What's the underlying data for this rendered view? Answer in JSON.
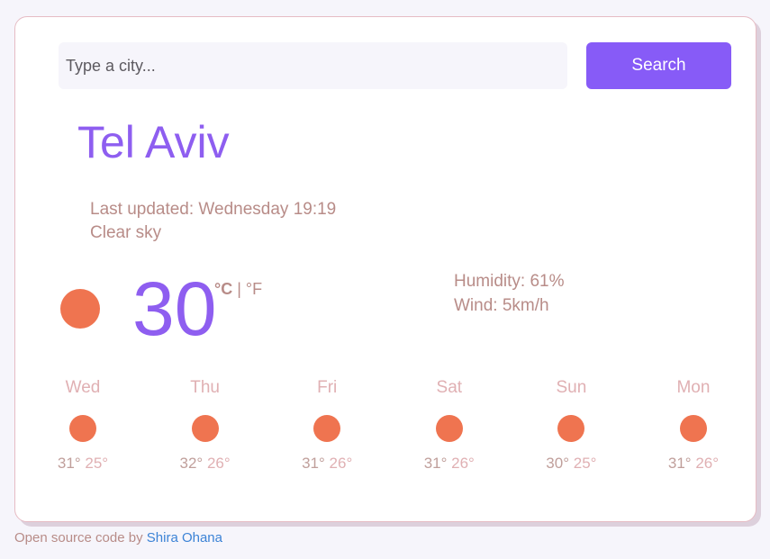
{
  "search": {
    "placeholder": "Type a city...",
    "value": "",
    "button_label": "Search"
  },
  "weather": {
    "city": "Tel Aviv",
    "last_updated": "Last updated: Wednesday 19:19",
    "description": "Clear sky",
    "temperature": "30",
    "unit_celsius": "°C",
    "unit_separator": "|",
    "unit_fahrenheit": "°F",
    "humidity": "Humidity: 61%",
    "wind": "Wind: 5km/h",
    "icon": "sun-icon"
  },
  "forecast": [
    {
      "day": "Wed",
      "max": "31°",
      "min": "25°",
      "icon": "sun-icon"
    },
    {
      "day": "Thu",
      "max": "32°",
      "min": "26°",
      "icon": "sun-icon"
    },
    {
      "day": "Fri",
      "max": "31°",
      "min": "26°",
      "icon": "sun-icon"
    },
    {
      "day": "Sat",
      "max": "31°",
      "min": "26°",
      "icon": "sun-icon"
    },
    {
      "day": "Sun",
      "max": "30°",
      "min": "25°",
      "icon": "sun-icon"
    },
    {
      "day": "Mon",
      "max": "31°",
      "min": "26°",
      "icon": "sun-icon"
    }
  ],
  "footer": {
    "text": "Open source code by",
    "link_text": "Shira Ohana"
  },
  "colors": {
    "accent": "#875bf7",
    "city_text": "#8e5ef0",
    "sun": "#ef7450",
    "muted_text": "#b88c88",
    "link": "#3c83d6"
  }
}
